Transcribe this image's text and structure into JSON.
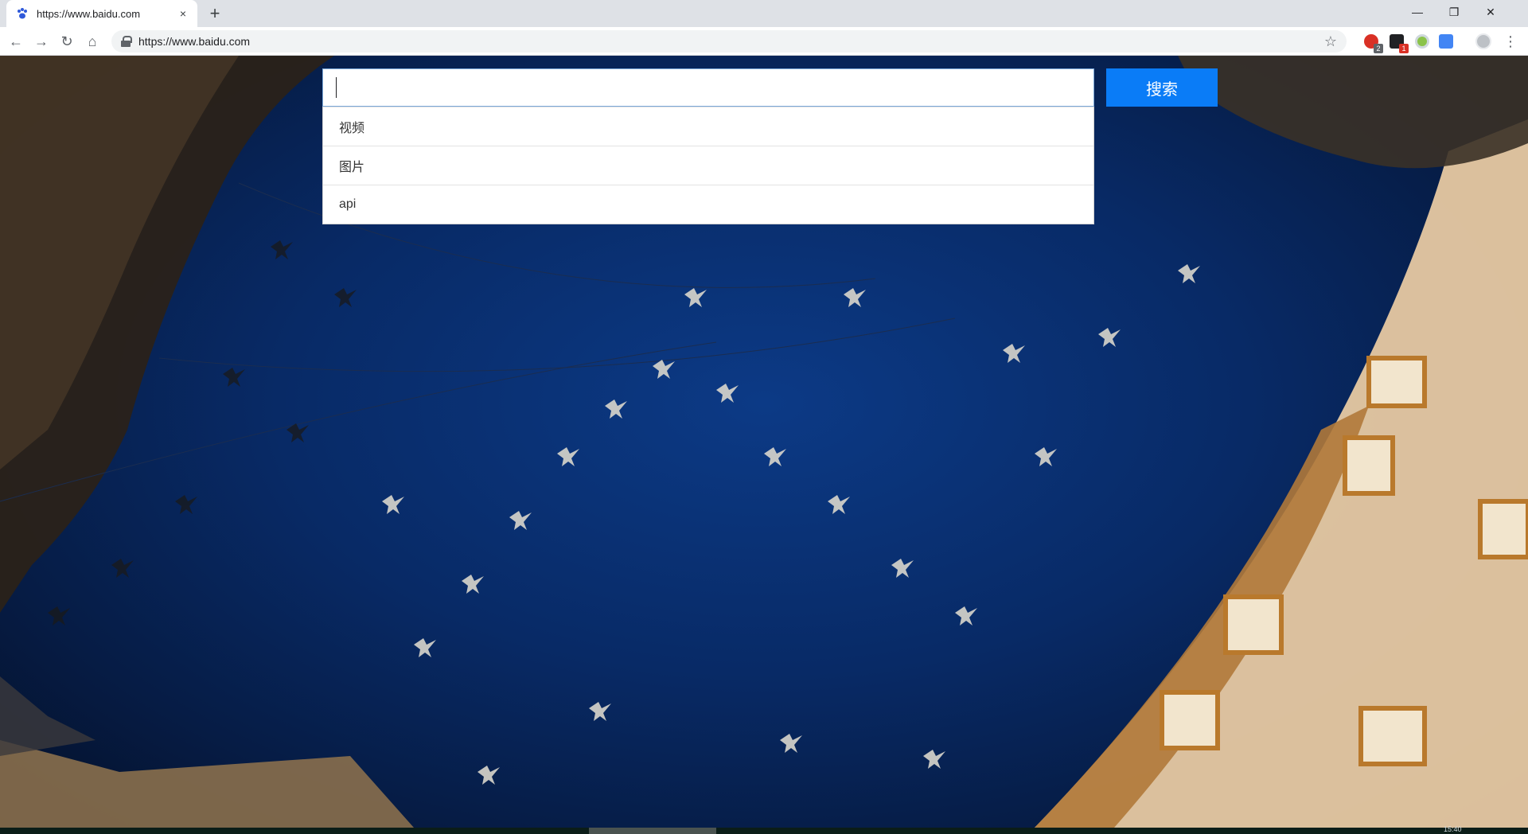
{
  "browser": {
    "tab": {
      "title": "https://www.baidu.com",
      "favicon": "baidu-paw-icon",
      "close_icon": "×"
    },
    "new_tab_icon": "+",
    "window_controls": {
      "minimize": "—",
      "maximize": "❐",
      "close": "✕"
    },
    "toolbar": {
      "back_icon": "←",
      "forward_icon": "→",
      "reload_icon": "↻",
      "home_icon": "⌂",
      "url": "https://www.baidu.com",
      "star_icon": "☆",
      "menu_icon": "⋮"
    },
    "extensions": [
      {
        "name": "extension-red",
        "badge": "2"
      },
      {
        "name": "extension-dark",
        "badge": "1"
      },
      {
        "name": "extension-green",
        "badge": ""
      },
      {
        "name": "extension-translate",
        "badge": ""
      }
    ]
  },
  "search": {
    "input_value": "",
    "button_label": "搜索",
    "suggestions": [
      "视频",
      "图片",
      "api"
    ]
  },
  "taskbar": {
    "clock": "15:40"
  },
  "colors": {
    "search_button": "#0a7cf7",
    "sky": "#082a66"
  }
}
